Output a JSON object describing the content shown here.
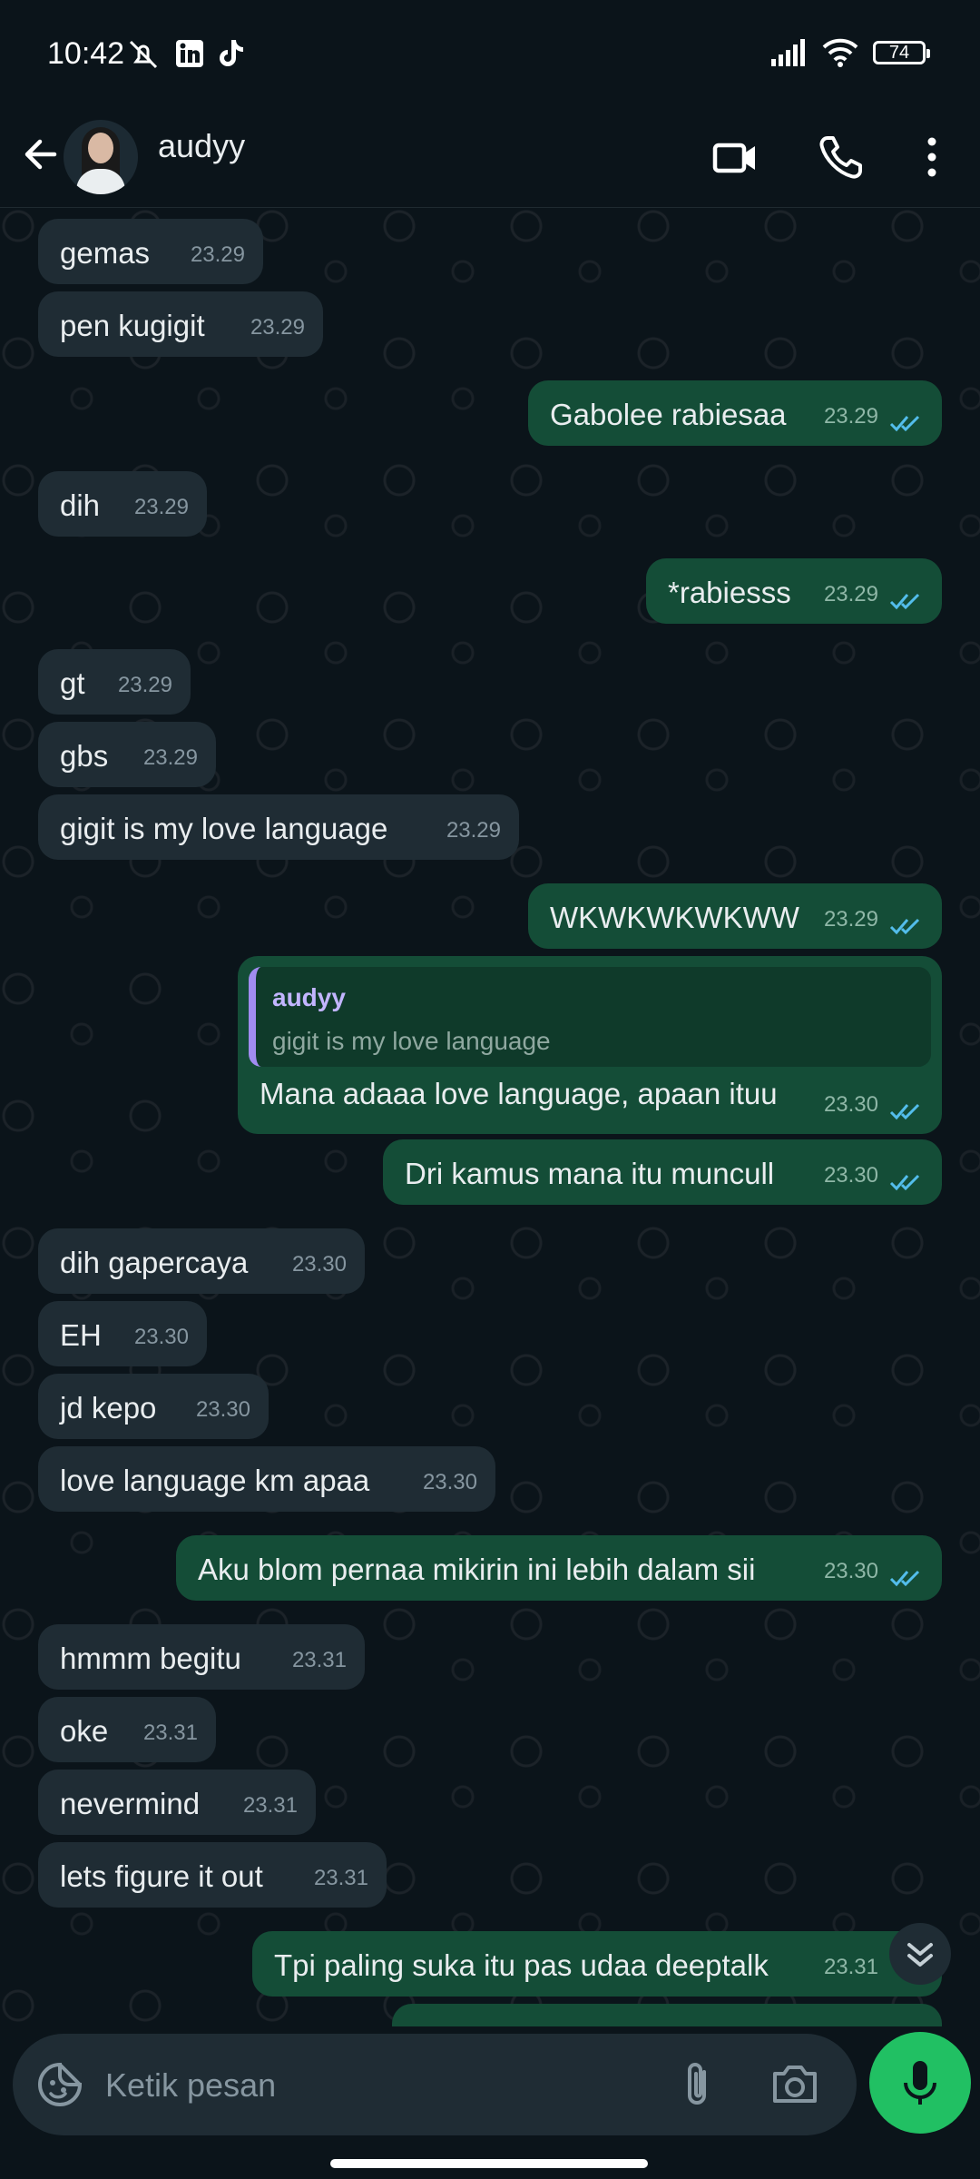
{
  "status_bar": {
    "time": "10:42",
    "battery": "74"
  },
  "header": {
    "contact_name": "audyy"
  },
  "messages": [
    {
      "text": "gemas",
      "time": "23.29",
      "dir": "in"
    },
    {
      "text": "pen kugigit",
      "time": "23.29",
      "dir": "in"
    },
    {
      "text": "Gabolee rabiesaa",
      "time": "23.29",
      "dir": "out"
    },
    {
      "text": "dih",
      "time": "23.29",
      "dir": "in"
    },
    {
      "text": "*rabiesss",
      "time": "23.29",
      "dir": "out"
    },
    {
      "text": "gt",
      "time": "23.29",
      "dir": "in"
    },
    {
      "text": "gbs",
      "time": "23.29",
      "dir": "in"
    },
    {
      "text": "gigit is my love language",
      "time": "23.29",
      "dir": "in"
    },
    {
      "text": "WKWKWKWKWW",
      "time": "23.29",
      "dir": "out"
    },
    {
      "text": "Mana adaaa love language, apaan ituu",
      "time": "23.30",
      "dir": "out",
      "reply": {
        "name": "audyy",
        "text": "gigit is my love language"
      }
    },
    {
      "text": "Dri kamus mana itu muncull",
      "time": "23.30",
      "dir": "out"
    },
    {
      "text": "dih gapercaya",
      "time": "23.30",
      "dir": "in"
    },
    {
      "text": "EH",
      "time": "23.30",
      "dir": "in"
    },
    {
      "text": "jd kepo",
      "time": "23.30",
      "dir": "in"
    },
    {
      "text": "love language km apaa",
      "time": "23.30",
      "dir": "in"
    },
    {
      "text": "Aku blom pernaa mikirin ini lebih dalam sii",
      "time": "23.30",
      "dir": "out"
    },
    {
      "text": "hmmm begitu",
      "time": "23.31",
      "dir": "in"
    },
    {
      "text": "oke",
      "time": "23.31",
      "dir": "in"
    },
    {
      "text": "nevermind",
      "time": "23.31",
      "dir": "in"
    },
    {
      "text": "lets figure it out",
      "time": "23.31",
      "dir": "in"
    },
    {
      "text": "Tpi paling suka itu pas udaa deeptalk",
      "time": "23.31",
      "dir": "out"
    }
  ],
  "composer": {
    "placeholder": "Ketik pesan"
  },
  "colors": {
    "incoming": "#1f2c34",
    "outgoing": "#144d37",
    "tick": "#53bdeb",
    "mic": "#21c063"
  }
}
